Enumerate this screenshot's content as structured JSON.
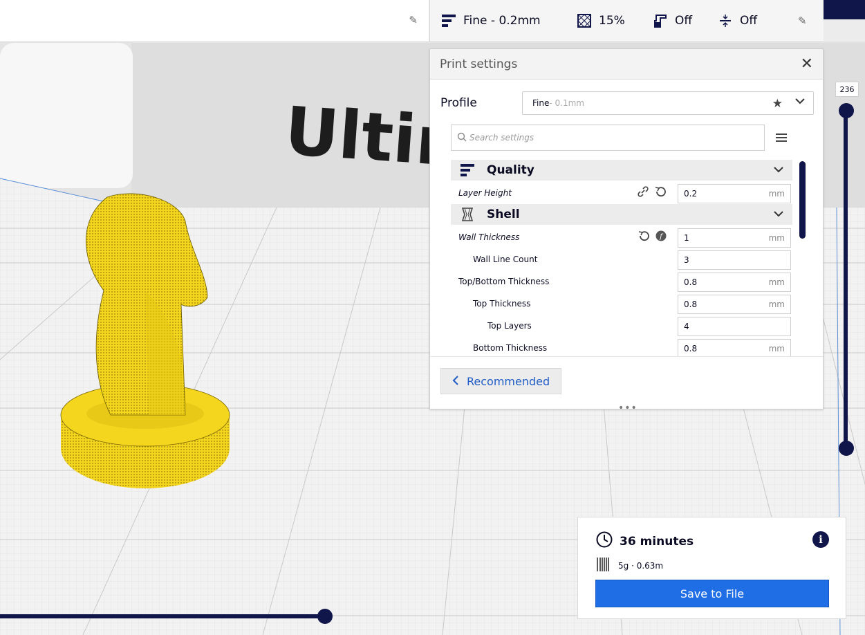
{
  "viewport": {
    "brand_text": "Ultim",
    "colors": {
      "model": "#f4d61f",
      "plate": "#f2f2f2",
      "accent": "#10154a"
    }
  },
  "topbar": {
    "profile_label": "Fine - 0.2mm",
    "infill_label": "15%",
    "support_label": "Off",
    "adhesion_label": "Off"
  },
  "print_settings": {
    "title": "Print settings",
    "profile_label": "Profile",
    "profile_value": "Fine",
    "profile_suffix": " - 0.1mm",
    "search_placeholder": "Search settings",
    "categories": [
      {
        "label": "Quality",
        "icon": "quality-icon"
      },
      {
        "label": "Shell",
        "icon": "shell-icon"
      }
    ],
    "settings": [
      {
        "label": "Layer Height",
        "value": "0.2",
        "unit": "mm"
      },
      {
        "label": "Wall Thickness",
        "value": "1",
        "unit": "mm"
      },
      {
        "label": "Wall Line Count",
        "value": "3",
        "unit": ""
      },
      {
        "label": "Top/Bottom Thickness",
        "value": "0.8",
        "unit": "mm"
      },
      {
        "label": "Top Thickness",
        "value": "0.8",
        "unit": "mm"
      },
      {
        "label": "Top Layers",
        "value": "4",
        "unit": ""
      },
      {
        "label": "Bottom Thickness",
        "value": "0.8",
        "unit": "mm"
      }
    ],
    "recommended_label": "Recommended"
  },
  "layer_slider": {
    "value": "236"
  },
  "estimate": {
    "time": "36 minutes",
    "material": "5g · 0.63m",
    "save_label": "Save to File"
  }
}
